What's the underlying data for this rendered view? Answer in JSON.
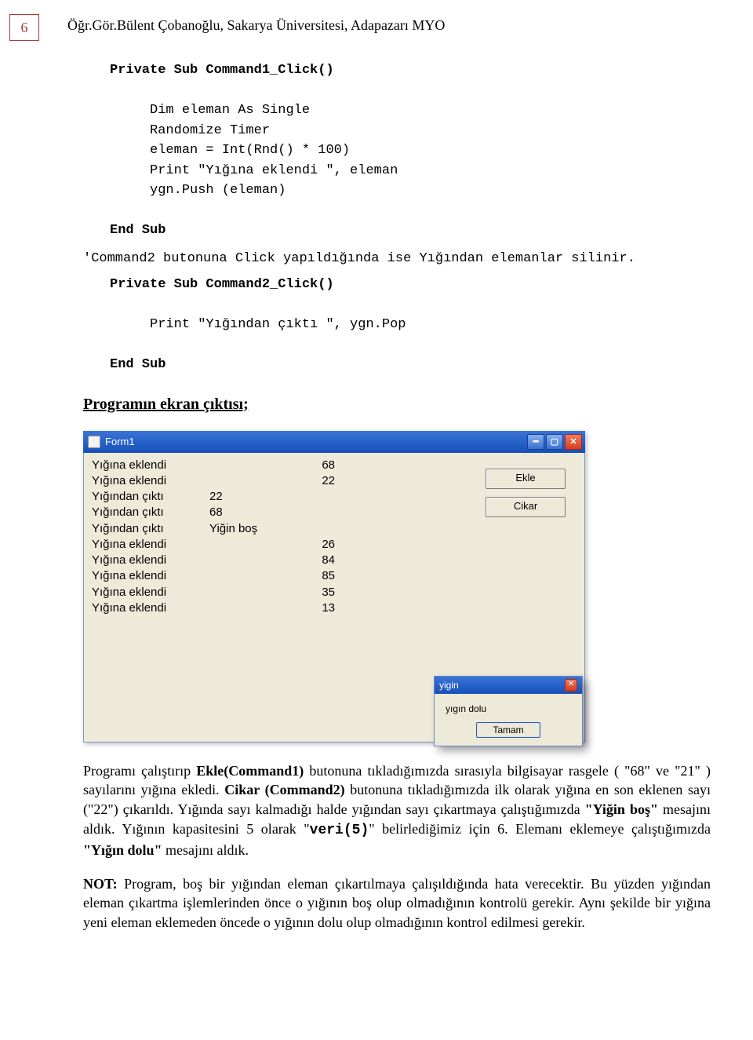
{
  "page_number": "6",
  "header": "Öğr.Gör.Bülent Çobanoğlu, Sakarya Üniversitesi, Adapazarı MYO",
  "code1": {
    "sig": "Private Sub Command1_Click()",
    "l1": "Dim eleman As Single",
    "l2": "Randomize Timer",
    "l3": "eleman = Int(Rnd() * 100)",
    "l4": "Print \"Yığına eklendi \", eleman",
    "l5": "ygn.Push (eleman)",
    "end": "End Sub"
  },
  "comment": "'Command2 butonuna Click yapıldığında ise Yığından elemanlar silinir.",
  "code2": {
    "sig": "Private Sub Command2_Click()",
    "l1": "Print \"Yığından çıktı \", ygn.Pop",
    "end": "End Sub"
  },
  "section_heading": "Programın ekran çıktısı;",
  "window": {
    "title": "Form1",
    "btn_ekle": "Ekle",
    "btn_cikar": "Cikar",
    "output": [
      {
        "label": "Yığına eklendi",
        "mid": "",
        "val": "68"
      },
      {
        "label": "Yığına eklendi",
        "mid": "",
        "val": "22"
      },
      {
        "label": "Yığından çıktı",
        "mid": "22",
        "val": ""
      },
      {
        "label": "Yığından çıktı",
        "mid": "68",
        "val": ""
      },
      {
        "label": "Yığından çıktı",
        "mid": "Yiğin boş",
        "val": ""
      },
      {
        "label": "Yığına eklendi",
        "mid": "",
        "val": "26"
      },
      {
        "label": "Yığına eklendi",
        "mid": "",
        "val": "84"
      },
      {
        "label": "Yığına eklendi",
        "mid": "",
        "val": "85"
      },
      {
        "label": "Yığına eklendi",
        "mid": "",
        "val": "35"
      },
      {
        "label": "Yığına eklendi",
        "mid": "",
        "val": "13"
      }
    ],
    "dialog": {
      "title": "yigin",
      "message": "yıgın dolu",
      "ok": "Tamam"
    }
  },
  "para1_a": "Programı çalıştırıp ",
  "para1_b": "Ekle(Command1)",
  "para1_c": " butonuna tıkladığımızda sırasıyla bilgisayar rasgele ( \"68\" ve \"21\" ) sayılarını yığına ekledi. ",
  "para1_d": "Cikar (Command2)",
  "para1_e": " butonuna tıkladığımızda ilk olarak yığına en son eklenen sayı (\"22\") çıkarıldı. Yığında sayı kalmadığı halde yığından sayı çıkartmaya çalıştığımızda ",
  "para1_f": "\"Yiğin boş\"",
  "para1_g": " mesajını aldık. Yığının kapasitesini 5 olarak \"",
  "para1_h": "veri(5)",
  "para1_i": "\" belirlediğimiz için 6. Elemanı eklemeye çalıştığımızda ",
  "para1_j": "\"Yığın dolu\"",
  "para1_k": " mesajını aldık.",
  "para2_a": "NOT:",
  "para2_b": " Program, boş bir yığından eleman çıkartılmaya çalışıldığında hata verecektir. Bu yüzden yığından eleman çıkartma işlemlerinden önce o yığının boş olup olmadığının kontrolü gerekir. Aynı şekilde bir yığına yeni eleman eklemeden öncede o yığının dolu olup olmadığının kontrol edilmesi gerekir."
}
